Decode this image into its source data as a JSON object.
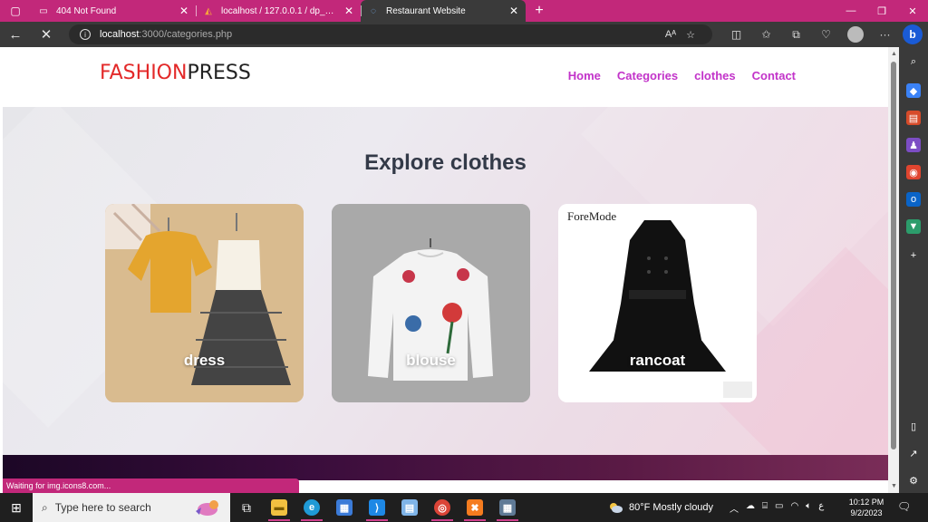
{
  "browser": {
    "tabs": [
      {
        "title": "404 Not Found",
        "icon": "page-icon"
      },
      {
        "title": "localhost / 127.0.0.1 / dp_admin",
        "icon": "phpmyadmin-icon"
      },
      {
        "title": "Restaurant Website",
        "icon": "loading-icon"
      }
    ],
    "address": {
      "host": "localhost",
      "path": ":3000/categories.php"
    },
    "status_text": "Waiting for img.icons8.com..."
  },
  "site": {
    "logo_part1": "FASHION",
    "logo_part2": "PRESS",
    "nav": [
      "Home",
      "Categories",
      "clothes",
      "Contact"
    ],
    "heading": "Explore clothes",
    "cards": [
      {
        "label": "dress"
      },
      {
        "label": "blouse"
      },
      {
        "label": "rancoat",
        "brand": "ForeMode"
      }
    ]
  },
  "taskbar": {
    "search_placeholder": "Type here to search",
    "weather": "80°F  Mostly cloudy",
    "time": "10:12 PM",
    "date": "9/2/2023",
    "lang": "ع"
  },
  "colors": {
    "accent": "#c2287a",
    "nav_link": "#c233c9",
    "logo_red": "#e32929",
    "heading": "#333a48"
  }
}
